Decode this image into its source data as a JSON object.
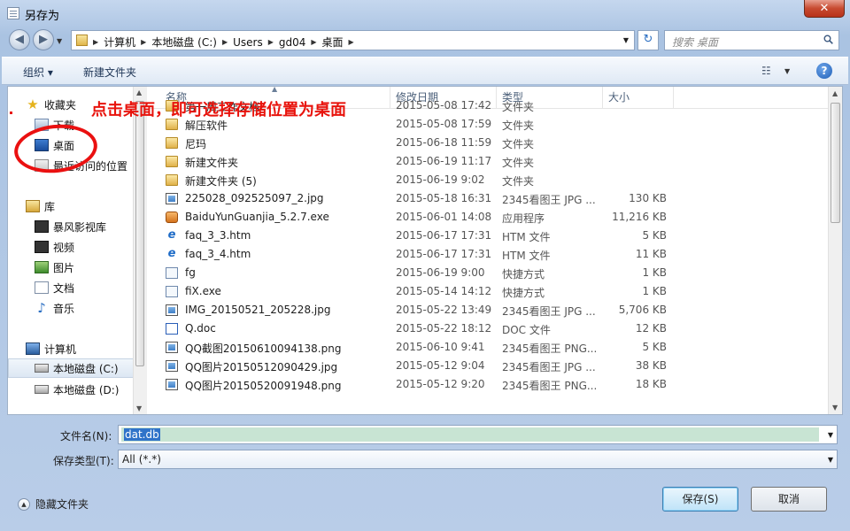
{
  "window": {
    "title": "另存为",
    "close": "✕"
  },
  "address": {
    "crumbs": [
      "计算机",
      "本地磁盘 (C:)",
      "Users",
      "gd04",
      "桌面"
    ],
    "search_placeholder": "搜索 桌面"
  },
  "toolbar": {
    "organize": "组织 ▾",
    "new_folder": "新建文件夹",
    "help": "?"
  },
  "nav": {
    "favorites": "收藏夹",
    "downloads": "下载",
    "desktop": "桌面",
    "recent": "最近访问的位置",
    "libraries": "库",
    "storm": "暴风影视库",
    "videos": "视频",
    "pictures": "图片",
    "documents": "文档",
    "music": "音乐",
    "computer": "计算机",
    "drive_c": "本地磁盘 (C:)",
    "drive_d": "本地磁盘 (D:)"
  },
  "columns": {
    "name": "名称",
    "date": "修改日期",
    "type": "类型",
    "size": "大小"
  },
  "files": [
    {
      "name": "第一周工作文档",
      "date": "2015-05-08 17:42",
      "type": "文件夹",
      "size": "",
      "icon": "folder"
    },
    {
      "name": "解压软件",
      "date": "2015-05-08 17:59",
      "type": "文件夹",
      "size": "",
      "icon": "folder"
    },
    {
      "name": "尼玛",
      "date": "2015-06-18 11:59",
      "type": "文件夹",
      "size": "",
      "icon": "folder"
    },
    {
      "name": "新建文件夹",
      "date": "2015-06-19 11:17",
      "type": "文件夹",
      "size": "",
      "icon": "folder"
    },
    {
      "name": "新建文件夹 (5)",
      "date": "2015-06-19 9:02",
      "type": "文件夹",
      "size": "",
      "icon": "folder"
    },
    {
      "name": "225028_092525097_2.jpg",
      "date": "2015-05-18 16:31",
      "type": "2345看图王 JPG ...",
      "size": "130 KB",
      "icon": "jpg"
    },
    {
      "name": "BaiduYunGuanjia_5.2.7.exe",
      "date": "2015-06-01 14:08",
      "type": "应用程序",
      "size": "11,216 KB",
      "icon": "exe"
    },
    {
      "name": "faq_3_3.htm",
      "date": "2015-06-17 17:31",
      "type": "HTM 文件",
      "size": "5 KB",
      "icon": "htm"
    },
    {
      "name": "faq_3_4.htm",
      "date": "2015-06-17 17:31",
      "type": "HTM 文件",
      "size": "11 KB",
      "icon": "htm"
    },
    {
      "name": "fg",
      "date": "2015-06-19 9:00",
      "type": "快捷方式",
      "size": "1 KB",
      "icon": "lnk"
    },
    {
      "name": "fiX.exe",
      "date": "2015-05-14 14:12",
      "type": "快捷方式",
      "size": "1 KB",
      "icon": "lnk"
    },
    {
      "name": "IMG_20150521_205228.jpg",
      "date": "2015-05-22 13:49",
      "type": "2345看图王 JPG ...",
      "size": "5,706 KB",
      "icon": "jpg"
    },
    {
      "name": "Q.doc",
      "date": "2015-05-22 18:12",
      "type": "DOC 文件",
      "size": "12 KB",
      "icon": "doc"
    },
    {
      "name": "QQ截图20150610094138.png",
      "date": "2015-06-10 9:41",
      "type": "2345看图王 PNG...",
      "size": "5 KB",
      "icon": "png"
    },
    {
      "name": "QQ图片20150512090429.jpg",
      "date": "2015-05-12 9:04",
      "type": "2345看图王 JPG ...",
      "size": "38 KB",
      "icon": "jpg"
    },
    {
      "name": "QQ图片20150520091948.png",
      "date": "2015-05-12 9:20",
      "type": "2345看图王 PNG...",
      "size": "18 KB",
      "icon": "png"
    }
  ],
  "annotation": "点击桌面，即可选择存储位置为桌面",
  "form": {
    "filename_label": "文件名(N):",
    "filename_value": "dat.db",
    "savetype_label": "保存类型(T):",
    "savetype_value": "All (*.*)"
  },
  "footer": {
    "hide_folders": "隐藏文件夹",
    "save": "保存(S)",
    "cancel": "取消"
  },
  "colors": {
    "annotation": "#e8130c",
    "filename_highlight": "#c8e4d3"
  }
}
